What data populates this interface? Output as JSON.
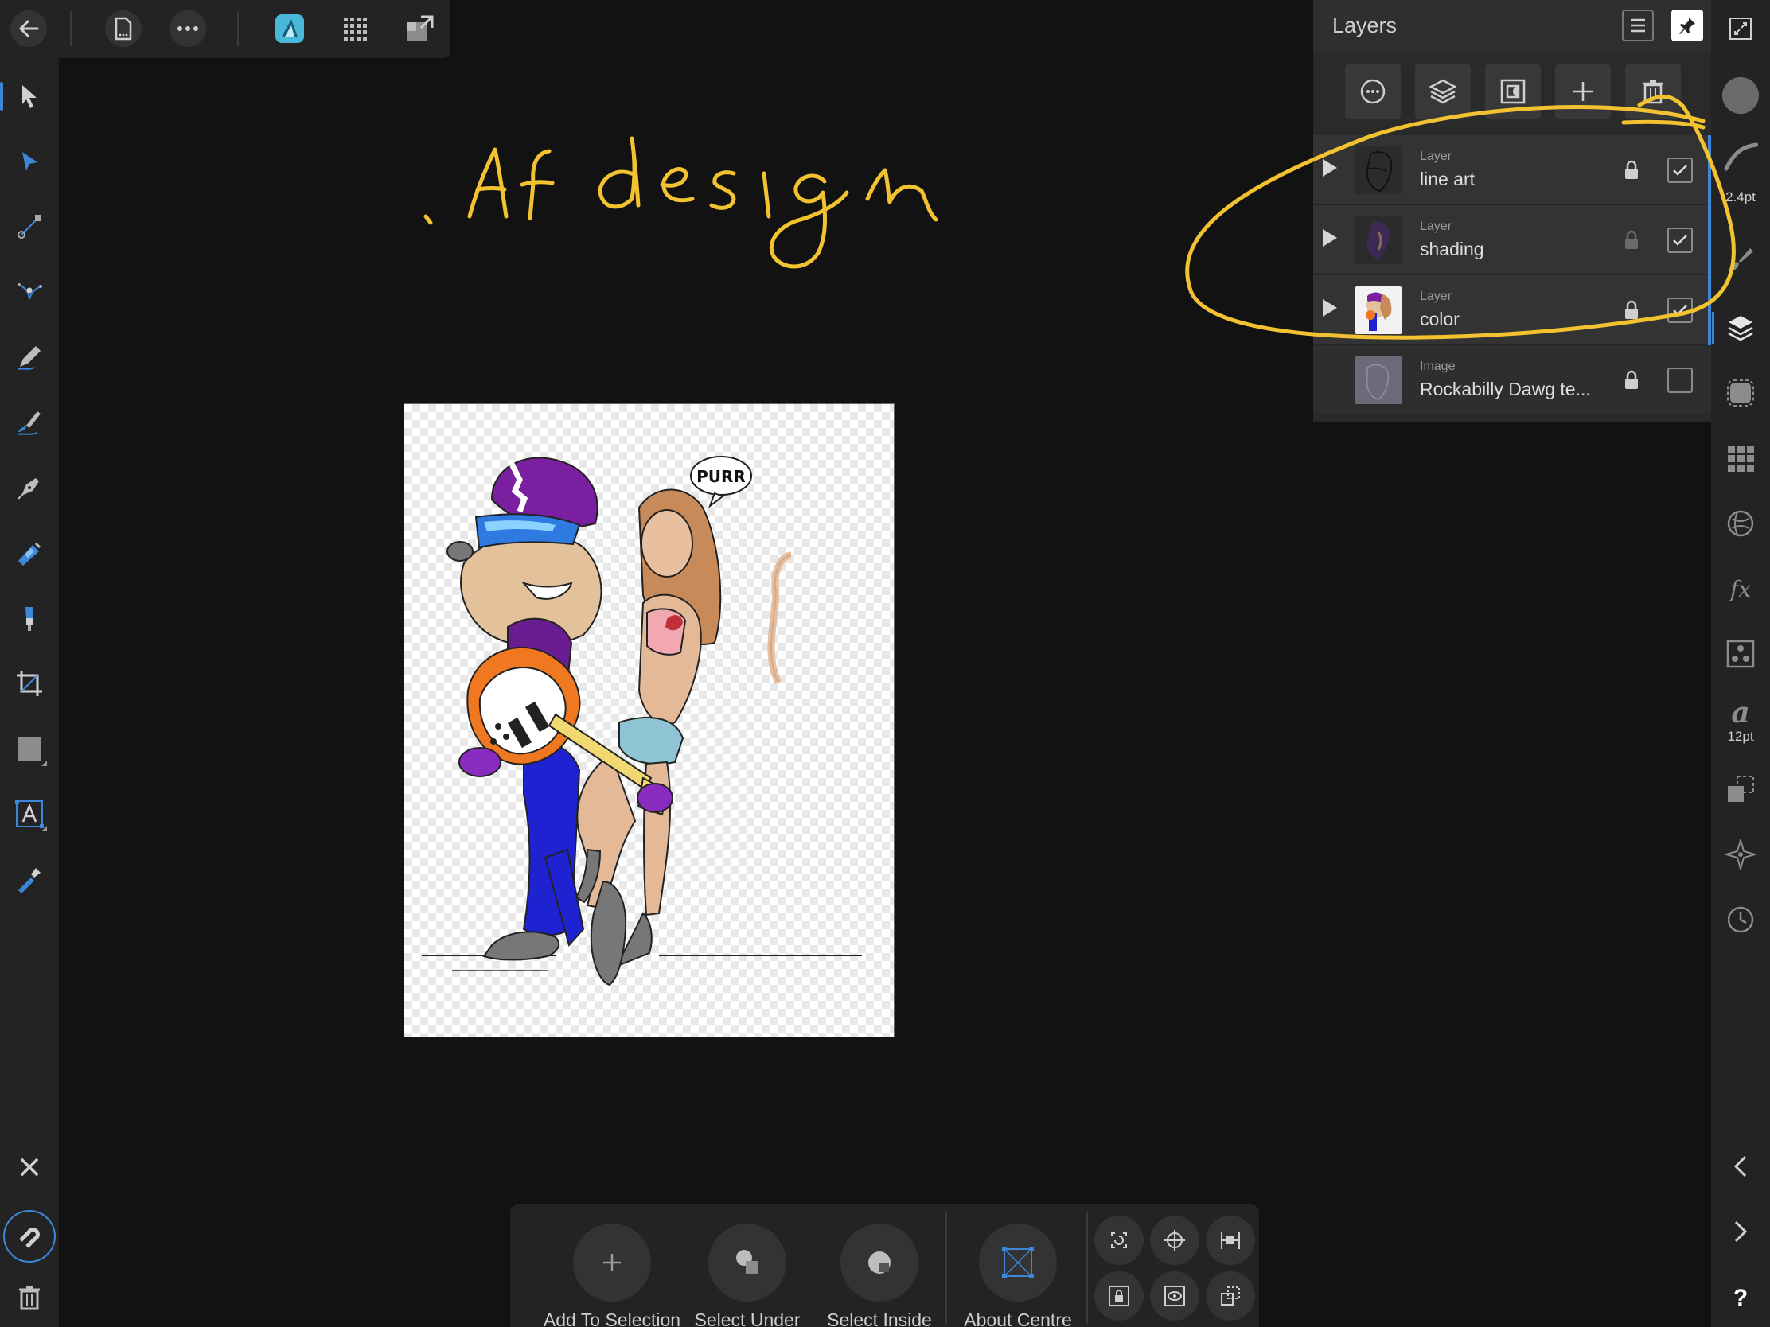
{
  "top_bar": {
    "icons": [
      "back-arrow-icon",
      "document-icon",
      "more-icon",
      "designer-persona-icon",
      "pixel-persona-icon",
      "export-persona-icon"
    ]
  },
  "left_tools": {
    "icons": [
      "move-tool-icon",
      "node-tool-icon",
      "point-transform-icon",
      "corner-tool-icon",
      "pencil-icon",
      "vector-brush-icon",
      "pen-tool-icon",
      "fill-tool-icon",
      "transparency-tool-icon",
      "crop-tool-icon",
      "rectangle-tool-icon",
      "artistic-text-icon",
      "color-picker-icon"
    ],
    "bottom_icons": [
      "close-icon",
      "snapping-icon",
      "trash-icon"
    ]
  },
  "right_bar": {
    "stroke_width": "2.4pt",
    "font_size": "12pt"
  },
  "layers_panel": {
    "title": "Layers",
    "layers": [
      {
        "type": "Layer",
        "name": "line art",
        "expandable": true,
        "locked": true,
        "visible": true
      },
      {
        "type": "Layer",
        "name": "shading",
        "expandable": true,
        "locked": false,
        "visible": true
      },
      {
        "type": "Layer",
        "name": "color",
        "expandable": true,
        "locked": true,
        "visible": true
      },
      {
        "type": "Image",
        "name": "Rockabilly Dawg te...",
        "expandable": false,
        "locked": true,
        "visible": false
      }
    ]
  },
  "canvas": {
    "annotation_text": ".Af design",
    "speech_bubble": "PURR"
  },
  "context_bar": {
    "add_to_selection": "Add To Selection",
    "select_under": "Select Under",
    "select_inside": "Select Inside",
    "about_centre": "About Centre"
  },
  "colors": {
    "accent": "#3d86d9",
    "annotation": "#f2c230",
    "panel": "#232323",
    "canvas_bg": "#121212"
  }
}
